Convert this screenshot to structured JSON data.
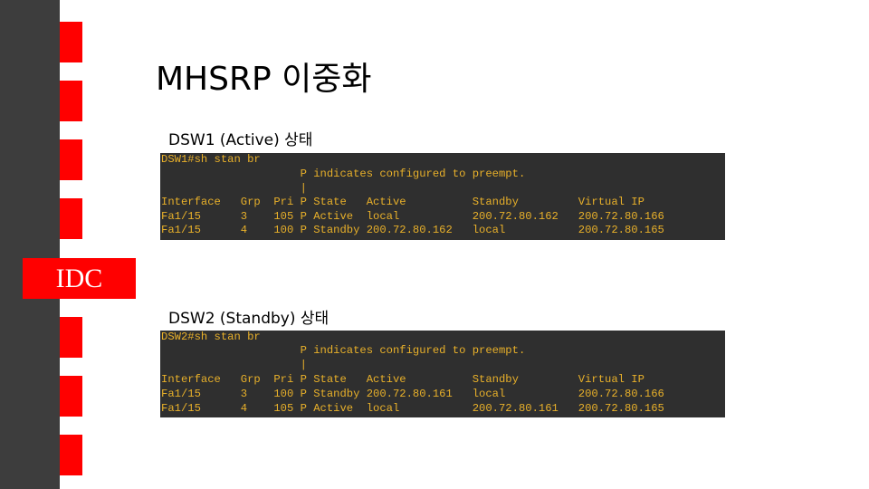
{
  "title": "MHSRP 이중화",
  "brand": {
    "label": "IDC"
  },
  "colors": {
    "accent": "#ff0000",
    "sidebar": "#3d3d3d",
    "terminal_bg": "#2f2f2f",
    "terminal_text": "#e8b02a"
  },
  "dsw1": {
    "label": "DSW1 (Active) 상태",
    "lines": [
      "DSW1#sh stan br",
      "                     P indicates configured to preempt.",
      "                     |",
      "Interface   Grp  Pri P State   Active          Standby         Virtual IP",
      "Fa1/15      3    105 P Active  local           200.72.80.162   200.72.80.166",
      "Fa1/15      4    100 P Standby 200.72.80.162   local           200.72.80.165"
    ]
  },
  "dsw2": {
    "label": "DSW2 (Standby) 상태",
    "lines": [
      "DSW2#sh stan br",
      "                     P indicates configured to preempt.",
      "                     |",
      "Interface   Grp  Pri P State   Active          Standby         Virtual IP",
      "Fa1/15      3    100 P Standby 200.72.80.161   local           200.72.80.166",
      "Fa1/15      4    105 P Active  local           200.72.80.161   200.72.80.165"
    ]
  }
}
